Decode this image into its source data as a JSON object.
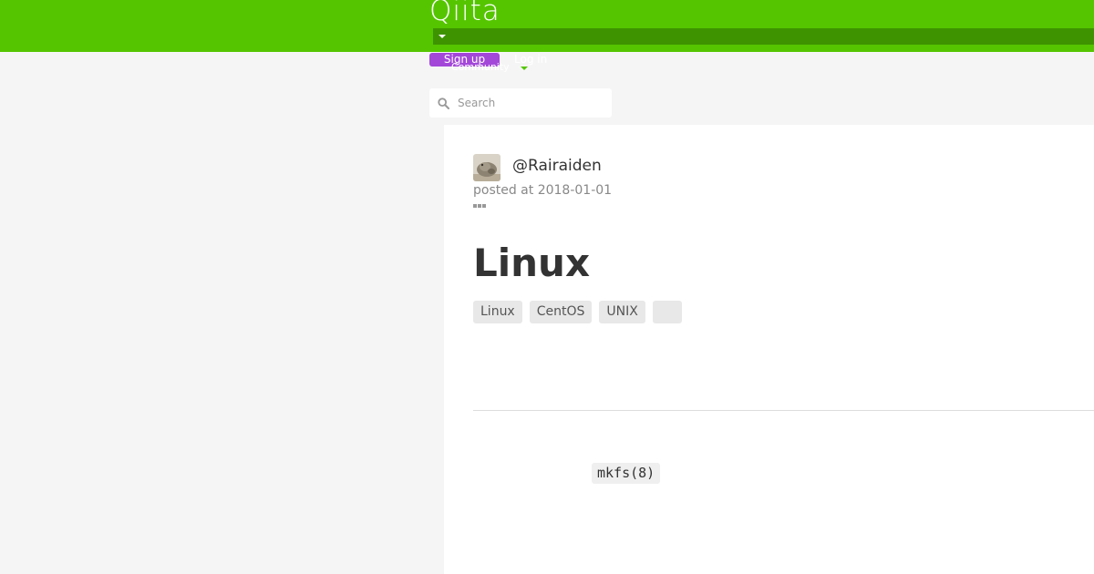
{
  "header": {
    "logo": "Qiita",
    "background_color": "#55c500",
    "nav_bar_color": "#3e9300",
    "nav_dropdown_icon": "caret-down-icon",
    "signup_label": "Sign up",
    "signup_color": "#a347d9",
    "login_label": "Log in",
    "community_label": "Community"
  },
  "search": {
    "placeholder": "Search",
    "value": "",
    "icon": "search-icon"
  },
  "article": {
    "author": {
      "name": "@Rairaiden",
      "avatar_icon": "user-avatar"
    },
    "posted_at": "posted at 2018-01-01",
    "more_icon": "more-options-icon",
    "title": "Linux",
    "tags": [
      "Linux",
      "CentOS",
      "UNIX",
      ""
    ],
    "body_code": "mkfs(8)"
  }
}
